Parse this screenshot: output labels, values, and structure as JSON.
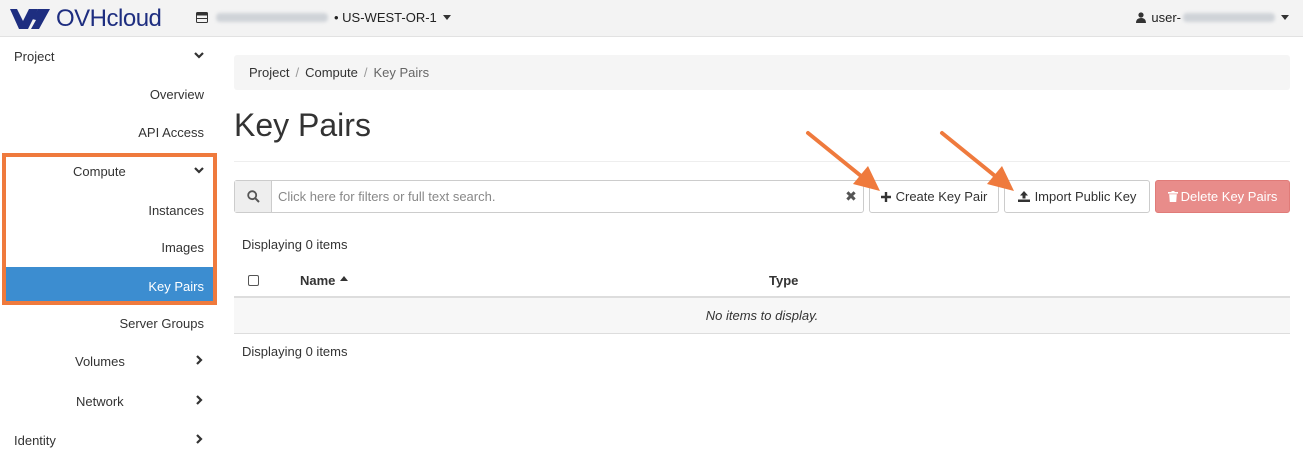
{
  "brand": {
    "logo_text": "OVHcloud"
  },
  "topbar": {
    "region": "US-WEST-OR-1",
    "user_prefix": "user-"
  },
  "sidebar": {
    "items": [
      {
        "label": "Project"
      },
      {
        "label": "Overview"
      },
      {
        "label": "API Access"
      },
      {
        "label": "Compute"
      },
      {
        "label": "Instances"
      },
      {
        "label": "Images"
      },
      {
        "label": "Key Pairs"
      },
      {
        "label": "Server Groups"
      },
      {
        "label": "Volumes"
      },
      {
        "label": "Network"
      },
      {
        "label": "Identity"
      }
    ]
  },
  "breadcrumb": {
    "items": [
      "Project",
      "Compute",
      "Key Pairs"
    ]
  },
  "page": {
    "title": "Key Pairs"
  },
  "search": {
    "placeholder": "Click here for filters or full text search."
  },
  "actions": {
    "create_label": "Create Key Pair",
    "import_label": "Import Public Key",
    "delete_label": "Delete Key Pairs"
  },
  "table": {
    "count_label": "Displaying 0 items",
    "columns": [
      "Name",
      "Type"
    ],
    "empty_text": "No items to display."
  },
  "colors": {
    "accent": "#3c8dd0",
    "annotation": "#ef7a3d",
    "danger": "#e88c8a",
    "brand": "#1e2e80"
  }
}
